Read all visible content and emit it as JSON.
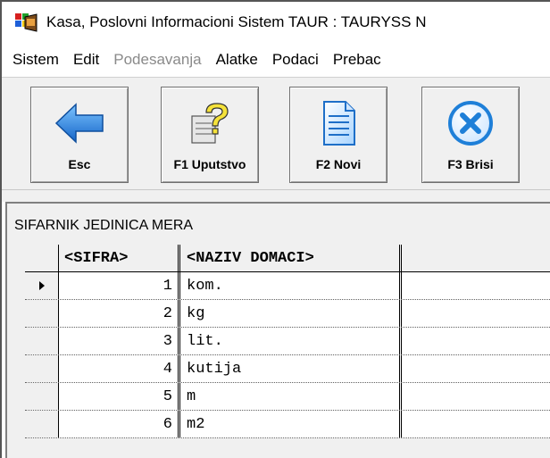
{
  "window": {
    "title": "Kasa, Poslovni Informacioni Sistem TAUR : TAURYSS N",
    "icon": "app-logo-icon"
  },
  "menu": [
    {
      "label": "Sistem",
      "enabled": true
    },
    {
      "label": "Edit",
      "enabled": true
    },
    {
      "label": "Podesavanja",
      "enabled": false
    },
    {
      "label": "Alatke",
      "enabled": true
    },
    {
      "label": "Podaci",
      "enabled": true
    },
    {
      "label": "Prebac",
      "enabled": true
    }
  ],
  "toolbar": [
    {
      "label": "Esc",
      "icon": "back-arrow-icon"
    },
    {
      "label": "F1 Uputstvo",
      "icon": "help-question-icon"
    },
    {
      "label": "F2 Novi",
      "icon": "new-document-icon"
    },
    {
      "label": "F3 Brisi",
      "icon": "delete-x-icon"
    }
  ],
  "grid": {
    "title": "SIFARNIK JEDINICA MERA",
    "columns": [
      "<SIFRA>",
      "<NAZIV DOMACI>"
    ],
    "rows": [
      {
        "sifra": "1",
        "naziv": "kom.",
        "current": true
      },
      {
        "sifra": "2",
        "naziv": "kg",
        "current": false
      },
      {
        "sifra": "3",
        "naziv": "lit.",
        "current": false
      },
      {
        "sifra": "4",
        "naziv": "kutija",
        "current": false
      },
      {
        "sifra": "5",
        "naziv": "m",
        "current": false
      },
      {
        "sifra": "6",
        "naziv": "m2",
        "current": false
      }
    ]
  },
  "colors": {
    "accent_blue": "#1e7fd8",
    "help_yellow": "#f5e23a",
    "disabled_text": "#8a8a8a"
  }
}
